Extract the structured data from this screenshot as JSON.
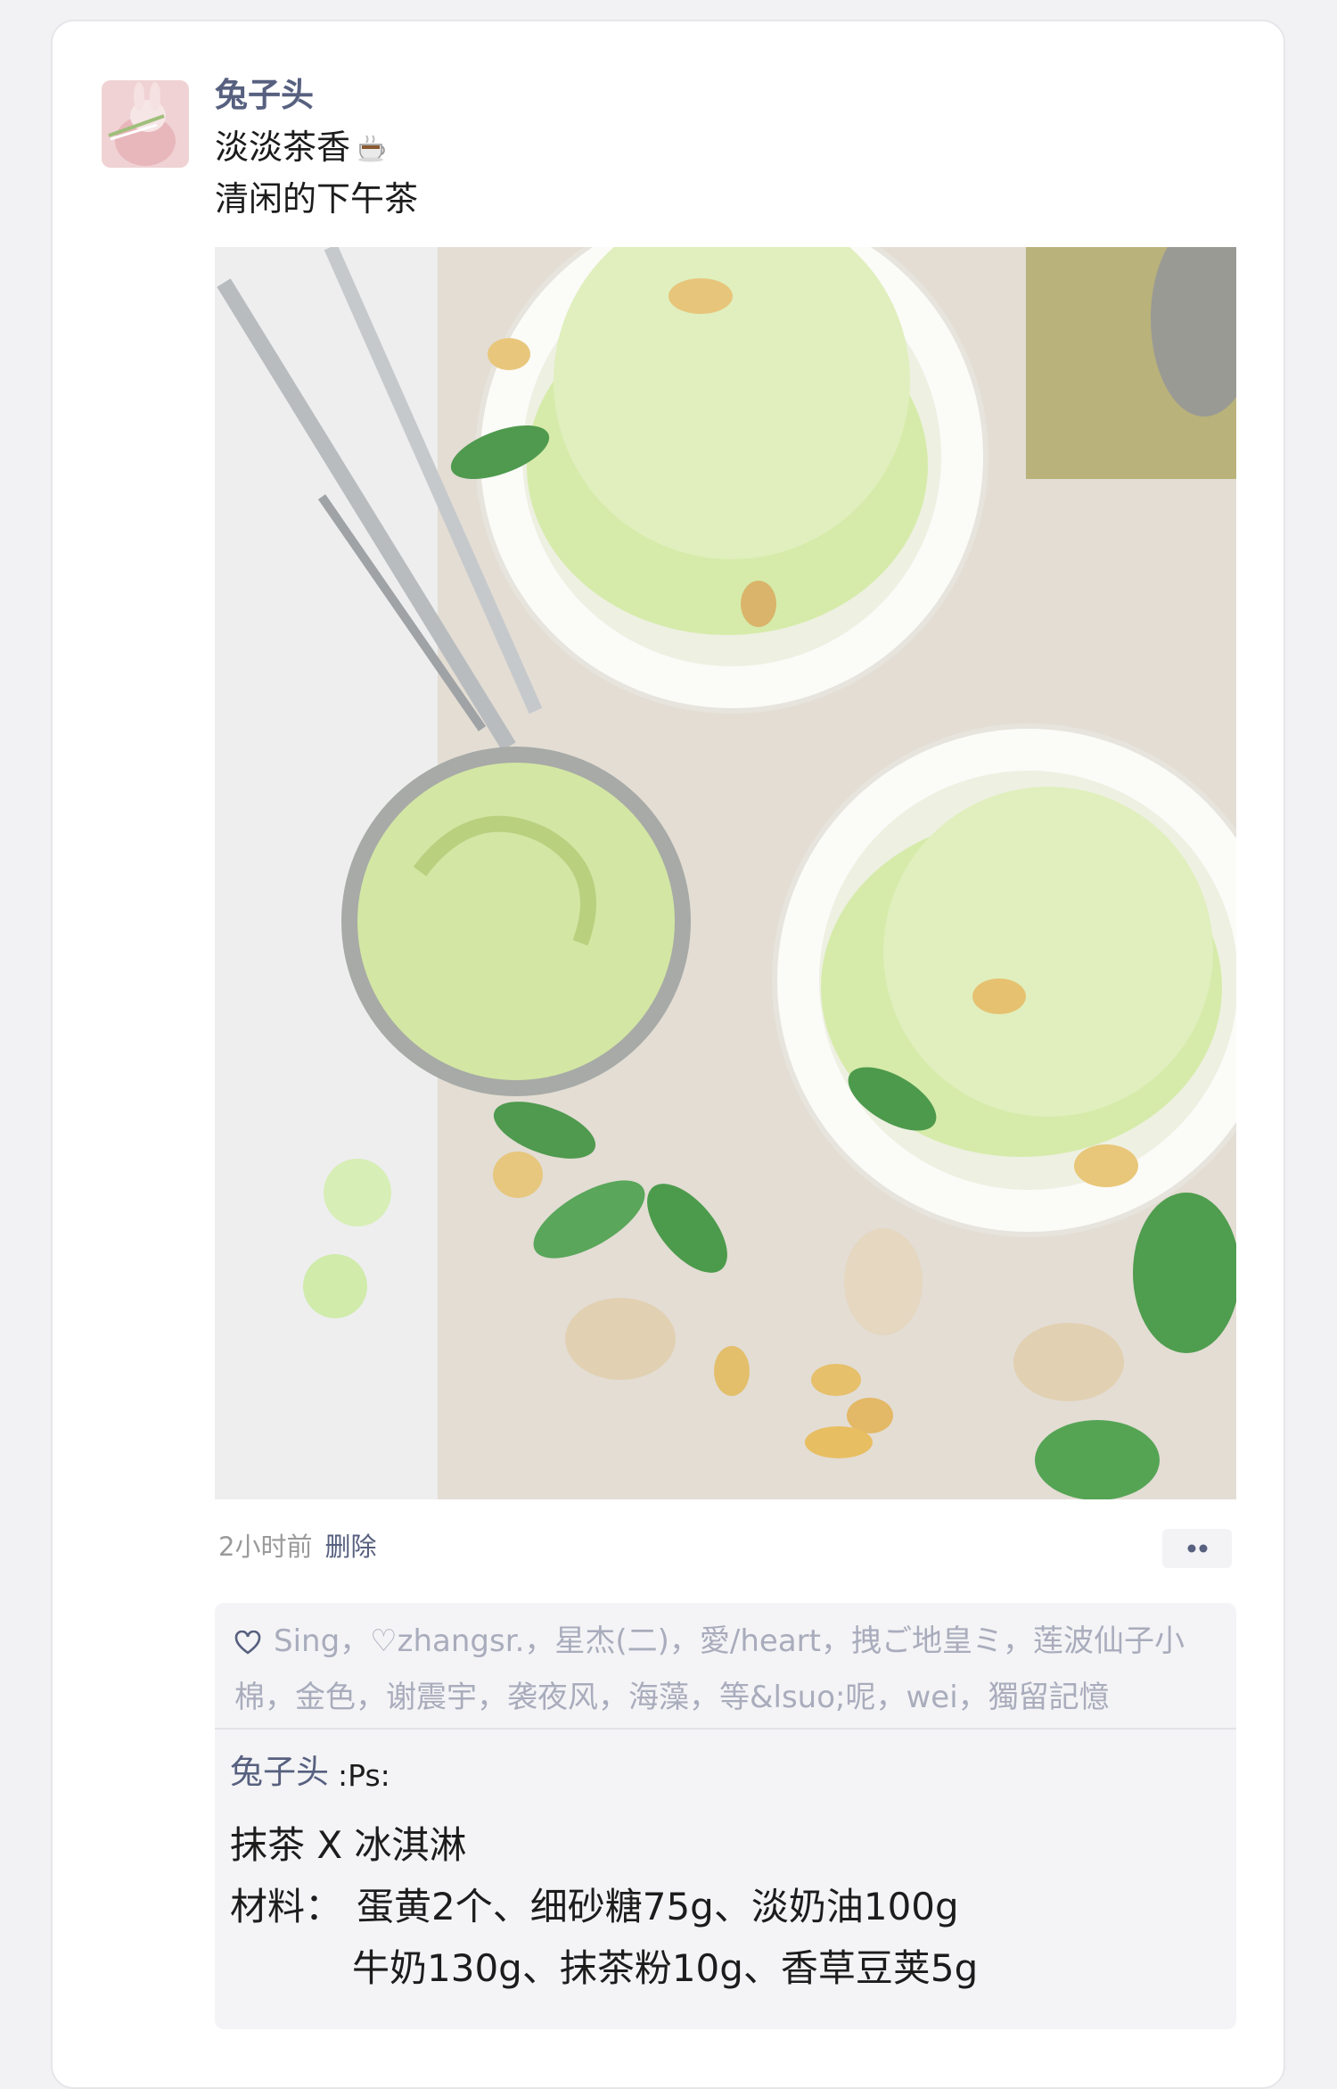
{
  "post": {
    "username": "兔子头",
    "text_line1": "淡淡茶香",
    "text_line2": "清闲的下午茶",
    "time": "2小时前",
    "delete_label": "删除"
  },
  "likes": {
    "names": "Sing，♡zhangsr.，星杰(二)，愛/heart，拽ご地皇ミ，莲波仙子小棉，金色，谢震宇，袭夜风，海藻，等&lsuo;呢，wei，獨留記憶"
  },
  "comment": {
    "author": "兔子头",
    "colon_ps": ":Ps:",
    "line1": "抹茶 X 冰淇淋",
    "line2_label": "材料：",
    "line2": "蛋黄2个、细砂糖75g、淡奶油100g",
    "line3": "牛奶130g、抹茶粉10g、香草豆荚5g"
  },
  "colors": {
    "name_blue": "#57607f",
    "likes_gray": "#a9acbc",
    "panel_bg": "#f4f4f6"
  },
  "icons": [
    "hot-beverage-icon",
    "heart-outline-icon",
    "more-dots-icon"
  ]
}
